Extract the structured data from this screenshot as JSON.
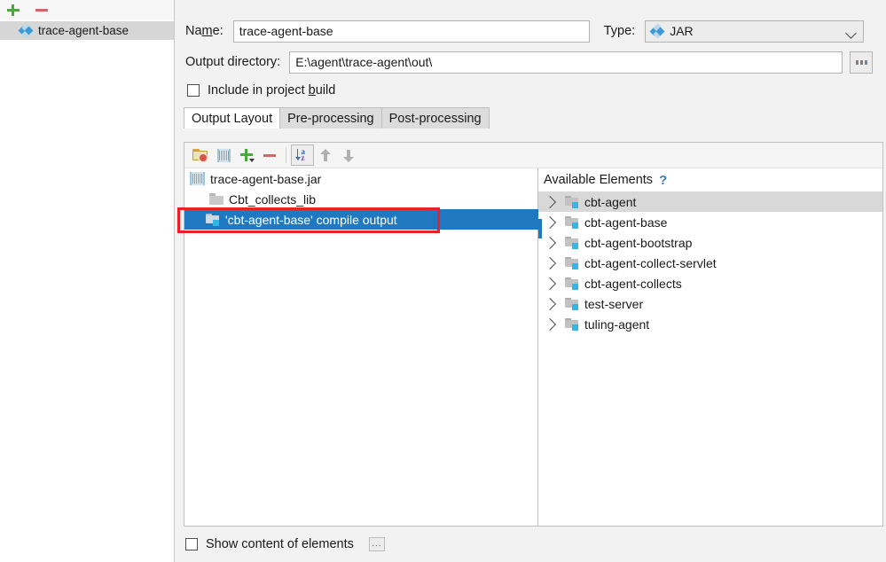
{
  "sidebar": {
    "add_label": "+",
    "remove_label": "−",
    "items": [
      {
        "label": "trace-agent-base",
        "icon": "jar-artifact-icon",
        "selected": true
      }
    ]
  },
  "form": {
    "name_label": "Name:",
    "name_value": "trace-agent-base",
    "type_label": "Type:",
    "type_value": "JAR",
    "type_icon": "jar-artifact-icon",
    "output_dir_label": "Output directory:",
    "output_dir_value": "E:\\agent\\trace-agent\\out\\",
    "browse_label": "...",
    "include_in_build_label": "Include in project build",
    "include_in_build_checked": false
  },
  "tabs": [
    {
      "label": "Output Layout",
      "active": true
    },
    {
      "label": "Pre-processing",
      "active": false
    },
    {
      "label": "Post-processing",
      "active": false
    }
  ],
  "toolbar": [
    {
      "name": "create-directory-icon",
      "tooltip": "Create Directory"
    },
    {
      "name": "create-archive-icon",
      "tooltip": "Create Archive"
    },
    {
      "name": "add-icon",
      "tooltip": "Add Copy of"
    },
    {
      "name": "remove-icon",
      "tooltip": "Remove"
    },
    {
      "name": "sort-alphabetically-icon",
      "tooltip": "Sort by Name",
      "active": true
    },
    {
      "name": "move-up-icon",
      "tooltip": "Move Up"
    },
    {
      "name": "move-down-icon",
      "tooltip": "Move Down"
    }
  ],
  "output_layout_tree": {
    "rows": [
      {
        "label": "trace-agent-base.jar",
        "icon": "archive-icon",
        "indent": 0,
        "selected": false
      },
      {
        "label": "Cbt_collects_lib",
        "icon": "folder-icon",
        "indent": 1,
        "selected": false
      },
      {
        "label": "'cbt-agent-base' compile output",
        "icon": "module-output-icon",
        "indent": 1,
        "selected": true
      }
    ]
  },
  "available_elements": {
    "title": "Available Elements",
    "help_label": "?",
    "rows": [
      {
        "label": "cbt-agent",
        "icon": "module-icon",
        "expandable": true,
        "hover": true
      },
      {
        "label": "cbt-agent-base",
        "icon": "module-icon",
        "expandable": true,
        "hover": false
      },
      {
        "label": "cbt-agent-bootstrap",
        "icon": "module-icon",
        "expandable": true,
        "hover": false
      },
      {
        "label": "cbt-agent-collect-servlet",
        "icon": "module-icon",
        "expandable": true,
        "hover": false
      },
      {
        "label": "cbt-agent-collects",
        "icon": "module-icon",
        "expandable": true,
        "hover": false
      },
      {
        "label": "test-server",
        "icon": "module-icon",
        "expandable": true,
        "hover": false
      },
      {
        "label": "tuling-agent",
        "icon": "module-icon",
        "expandable": true,
        "hover": false
      }
    ]
  },
  "footer": {
    "show_content_label": "Show content of elements",
    "show_content_checked": false,
    "dots_label": "..."
  },
  "colors": {
    "selection_blue": "#2079c0",
    "annotation_red": "#ec2024",
    "add_green": "#49a93c",
    "remove_red": "#cc6a61",
    "help_blue": "#3a7fc1"
  }
}
